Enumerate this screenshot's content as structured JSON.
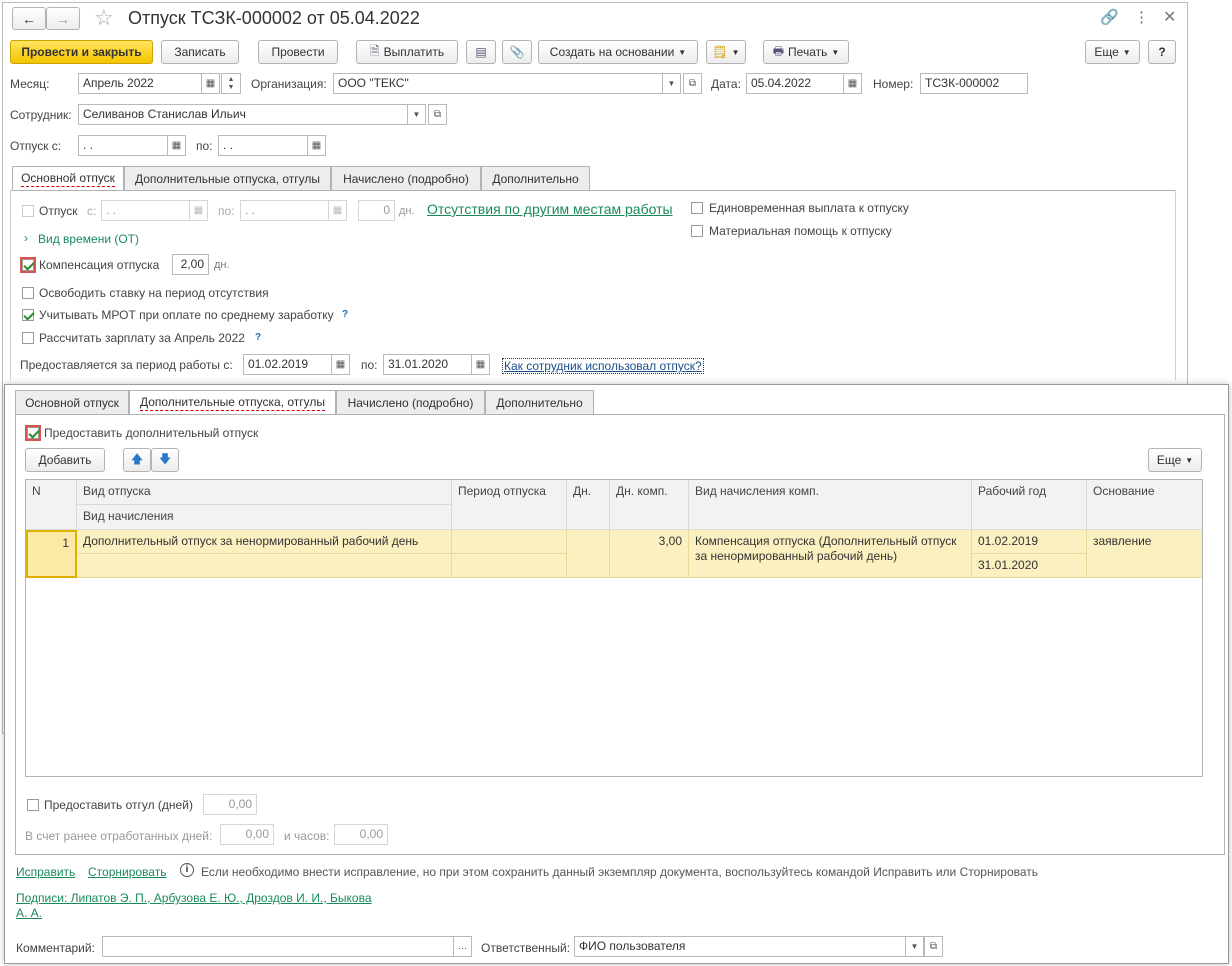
{
  "window": {
    "title": "Отпуск ТСЗК-000002 от 05.04.2022"
  },
  "toolbar": {
    "post_close": "Провести и закрыть",
    "save": "Записать",
    "post": "Провести",
    "pay": "Выплатить",
    "create_based": "Создать на основании",
    "print": "Печать",
    "more": "Еще",
    "help": "?"
  },
  "header": {
    "month_label": "Месяц:",
    "month_value": "Апрель 2022",
    "org_label": "Организация:",
    "org_value": "ООО \"ТЕКС\"",
    "date_label": "Дата:",
    "date_value": "05.04.2022",
    "number_label": "Номер:",
    "number_value": "ТСЗК-000002",
    "employee_label": "Сотрудник:",
    "employee_value": "Селиванов Станислав Ильич",
    "leave_from_label": "Отпуск с:",
    "leave_from_value": " .  .",
    "leave_to_label": "по:",
    "leave_to_value": " .  ."
  },
  "tabs": [
    "Основной отпуск",
    "Дополнительные отпуска, отгулы",
    "Начислено (подробно)",
    "Дополнительно"
  ],
  "main_tab": {
    "leave_cb": "Отпуск",
    "leave_s": "с:",
    "leave_s_value": " .  .",
    "leave_po": "по:",
    "leave_po_value": " .  .",
    "days_value": "0",
    "days_unit": "дн.",
    "absences_link": "Отсутствия по другим местам работы",
    "time_kind": "Вид времени (ОТ)",
    "compensation_label": "Компенсация отпуска",
    "compensation_value": "2,00",
    "compensation_unit": "дн.",
    "free_rate": "Освободить ставку на период отсутствия",
    "mrot": "Учитывать МРОТ при оплате по среднему заработку",
    "calc_salary": "Рассчитать зарплату за Апрель 2022",
    "help_mark": "?",
    "one_time": "Единовременная выплата к отпуску",
    "material_aid": "Материальная помощь к отпуску",
    "period_label": "Предоставляется за период работы с:",
    "period_from": "01.02.2019",
    "period_to_label": "по:",
    "period_to": "31.01.2020",
    "used_link": "Как сотрудник использовал отпуск?"
  },
  "extra_tab": {
    "provide_cb": "Предоставить дополнительный отпуск",
    "add_button": "Добавить",
    "more": "Еще",
    "columns": {
      "n": "N",
      "kind": "Вид отпуска",
      "accrual": "Вид начисления",
      "period": "Период отпуска",
      "days": "Дн.",
      "comp_days": "Дн. комп.",
      "comp_kind": "Вид начисления комп.",
      "work_year": "Рабочий год",
      "basis": "Основание"
    },
    "rows": [
      {
        "n": "1",
        "kind": "Дополнительный отпуск за ненормированный рабочий день",
        "comp_days": "3,00",
        "comp_kind": "Компенсация отпуска (Дополнительный отпуск за ненормированный рабочий день)",
        "work_year_from": "01.02.2019",
        "work_year_to": "31.01.2020",
        "basis": "заявление"
      }
    ],
    "dayoff_cb": "Предоставить отгул (дней)",
    "dayoff_value": "0,00",
    "worked_label": "В счет ранее отработанных дней:",
    "worked_days": "0,00",
    "hours_label": "и часов:",
    "worked_hours": "0,00"
  },
  "footer": {
    "fix_link": "Исправить",
    "storno_link": "Сторнировать",
    "info_text": "Если необходимо внести исправление, но при этом сохранить данный экземпляр документа, воспользуйтесь командой Исправить или Сторнировать",
    "signatures_line1": "Подписи: Липатов Э. П., Арбузова Е. Ю., Дроздов И. И., Быкова",
    "signatures_line2": "А. А.",
    "comment_label": "Комментарий:",
    "comment_value": "",
    "responsible_label": "Ответственный:",
    "responsible_value": "ФИО пользователя"
  }
}
